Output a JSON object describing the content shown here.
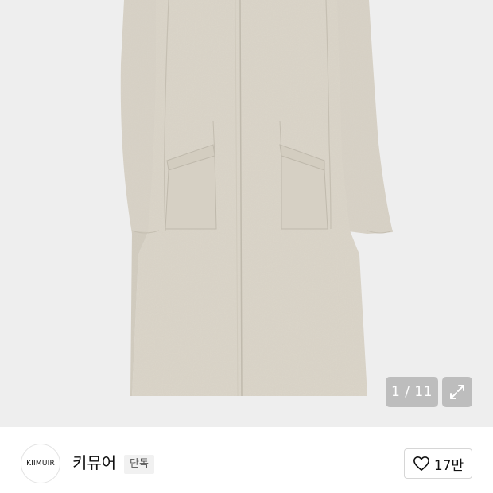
{
  "gallery": {
    "current_page": "1",
    "total_pages": "11",
    "counter_text": "1 / 11",
    "image_icon": "beige-wool-coat-product-photo",
    "expand_icon": "expand-arrows-icon"
  },
  "brand": {
    "logo_text": "KIIMUIR",
    "name": "키뮤어",
    "badge": "단독"
  },
  "like": {
    "icon": "heart-outline-icon",
    "count": "17만"
  },
  "colors": {
    "hero_background": "#eeeeee",
    "coat": "#d9d3c7",
    "overlay": "#969696",
    "text": "#111111"
  }
}
